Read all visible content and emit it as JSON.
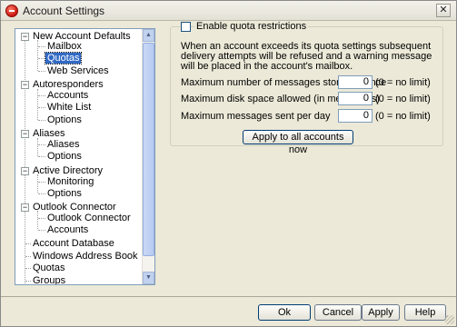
{
  "window": {
    "title": "Account Settings"
  },
  "tree": {
    "nodes": [
      {
        "label": "New Account Defaults",
        "expanded": true
      },
      {
        "label": "Mailbox"
      },
      {
        "label": "Quotas",
        "selected": true
      },
      {
        "label": "Web Services"
      },
      {
        "label": "Autoresponders",
        "expanded": true
      },
      {
        "label": "Accounts"
      },
      {
        "label": "White List"
      },
      {
        "label": "Options"
      },
      {
        "label": "Aliases",
        "expanded": true
      },
      {
        "label": "Aliases"
      },
      {
        "label": "Options"
      },
      {
        "label": "Active Directory",
        "expanded": true
      },
      {
        "label": "Monitoring"
      },
      {
        "label": "Options"
      },
      {
        "label": "Outlook Connector",
        "expanded": true
      },
      {
        "label": "Outlook Connector"
      },
      {
        "label": "Accounts"
      },
      {
        "label": "Account Database"
      },
      {
        "label": "Windows Address Book"
      },
      {
        "label": "Quotas"
      },
      {
        "label": "Groups"
      }
    ]
  },
  "quota": {
    "enable_label": "Enable quota restrictions",
    "enable_checked": false,
    "description": "When an account exceeds its quota settings subsequent delivery attempts will be refused and a warning message will be placed in the account's mailbox.",
    "rows": [
      {
        "label": "Maximum number of messages stored at once",
        "value": "0",
        "hint": "(0 = no limit)"
      },
      {
        "label": "Maximum disk space allowed (in megabytes)",
        "value": "0",
        "hint": "(0 = no limit)"
      },
      {
        "label": "Maximum messages sent per day",
        "value": "0",
        "hint": "(0 = no limit)"
      }
    ],
    "apply_all_label": "Apply to all accounts now"
  },
  "buttons": {
    "ok": "Ok",
    "cancel": "Cancel",
    "apply": "Apply",
    "help": "Help"
  },
  "colors": {
    "selection": "#316ac5",
    "dialog_bg": "#ece9d8",
    "border_blue": "#7f9db9"
  }
}
